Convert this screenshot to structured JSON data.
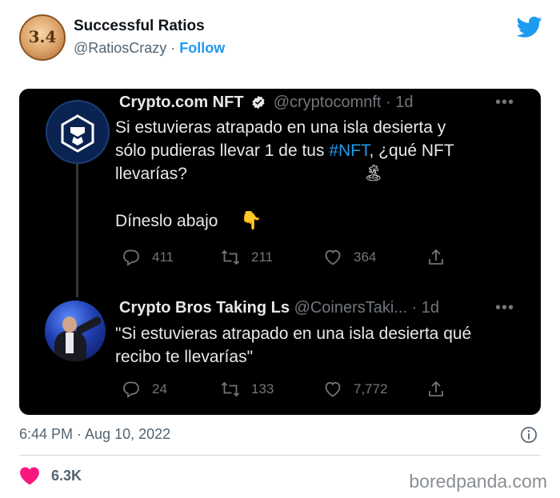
{
  "outer_tweet": {
    "avatar_text": "3.4",
    "name": "Successful Ratios",
    "handle": "@RatiosCrazy",
    "separator": " · ",
    "follow_label": "Follow",
    "timestamp": "6:44 PM · Aug 10, 2022",
    "like_count": "6.3K"
  },
  "embedded": {
    "tweet1": {
      "name": "Crypto.com NFT",
      "handle": "@cryptocomnft",
      "age": "· 1d",
      "body_line1": "Si estuvieras atrapado en una isla desierta y",
      "body_line2_pre": "sólo pudieras llevar 1 de tus ",
      "hashtag": "#NFT",
      "body_line2_post": ", ¿qué NFT",
      "body_line3": "llevarías?",
      "island_emoji": "🏝",
      "body_line5": "Díneslo abajo",
      "point_emoji": "👇",
      "replies": "411",
      "retweets": "211",
      "likes": "364"
    },
    "tweet2": {
      "name": "Crypto Bros Taking Ls",
      "handle": "@CoinersTaki...",
      "age": "· 1d",
      "body_line1": "\"Si estuvieras atrapado en una isla desierta qué",
      "body_line2": "recibo te llevarías\"",
      "replies": "24",
      "retweets": "133",
      "likes": "7,772"
    },
    "more_label": "•••"
  },
  "watermark": "boredpanda.com",
  "colors": {
    "accent": "#1d9bf0",
    "like_heart": "#f91880",
    "card_bg": "#000000",
    "muted": "#71767b"
  }
}
